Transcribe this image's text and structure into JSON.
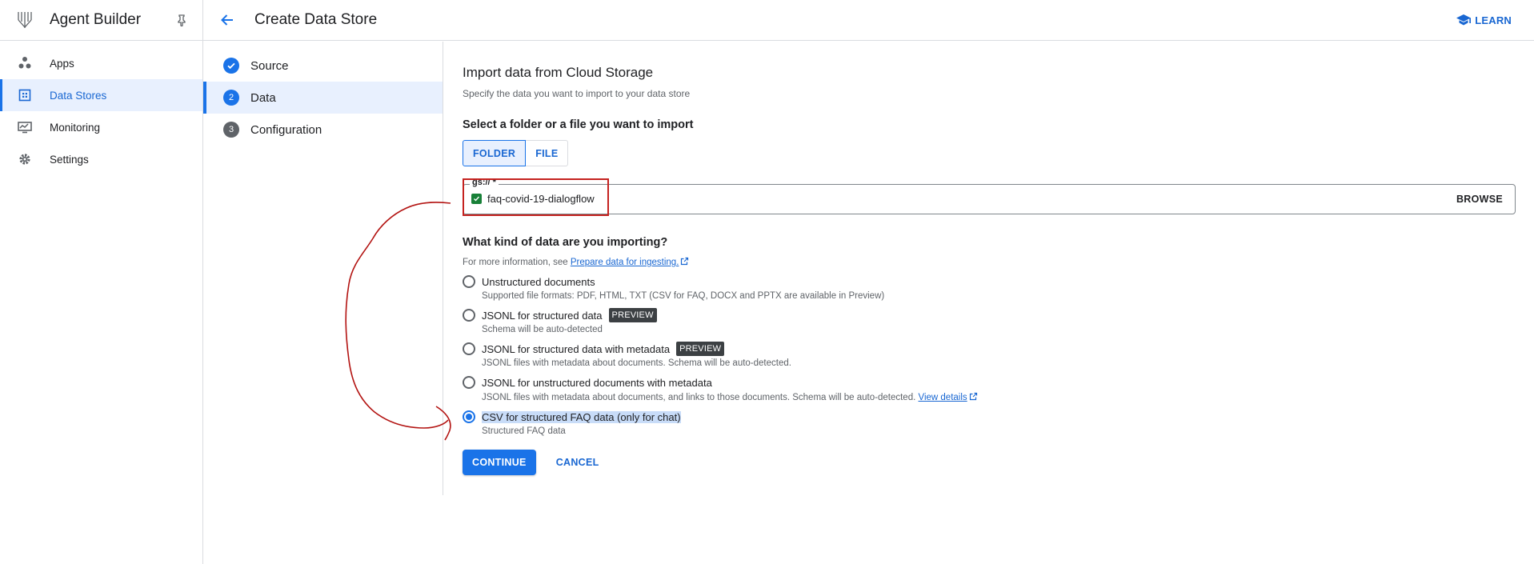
{
  "app": {
    "title": "Agent Builder"
  },
  "sidebar": {
    "items": [
      {
        "label": "Apps",
        "icon": "apps-icon"
      },
      {
        "label": "Data Stores",
        "icon": "data-stores-icon",
        "active": true
      },
      {
        "label": "Monitoring",
        "icon": "monitoring-icon"
      },
      {
        "label": "Settings",
        "icon": "gear-icon"
      }
    ]
  },
  "header": {
    "title": "Create Data Store",
    "learn_label": "LEARN"
  },
  "steps": [
    {
      "num": "",
      "label": "Source",
      "state": "done"
    },
    {
      "num": "2",
      "label": "Data",
      "state": "current"
    },
    {
      "num": "3",
      "label": "Configuration",
      "state": "pending"
    }
  ],
  "main": {
    "title": "Import data from Cloud Storage",
    "subtitle": "Specify the data you want to import to your data store",
    "select_heading": "Select a folder or a file you want to import",
    "toggle": {
      "folder": "FOLDER",
      "file": "FILE",
      "selected": "FOLDER"
    },
    "gs_field": {
      "label": "gs:// *",
      "value": "faq-covid-19-dialogflow",
      "browse": "BROWSE"
    },
    "kind_heading": "What kind of data are you importing?",
    "info_prefix": "For more information, see ",
    "info_link": "Prepare data for ingesting.",
    "options": [
      {
        "title": "Unstructured documents",
        "desc": "Supported file formats: PDF, HTML, TXT (CSV for FAQ, DOCX and PPTX are available in Preview)",
        "badge": ""
      },
      {
        "title": "JSONL for structured data",
        "desc": "Schema will be auto-detected",
        "badge": "PREVIEW"
      },
      {
        "title": "JSONL for structured data with metadata",
        "desc": "JSONL files with metadata about documents. Schema will be auto-detected.",
        "badge": "PREVIEW"
      },
      {
        "title": "JSONL for unstructured documents with metadata",
        "desc": "JSONL files with metadata about documents, and links to those documents. Schema will be auto-detected.",
        "badge": "",
        "link": "View details"
      },
      {
        "title": "CSV for structured FAQ data (only for chat)",
        "desc": "Structured FAQ data",
        "badge": "",
        "selected": true
      }
    ],
    "continue_label": "CONTINUE",
    "cancel_label": "CANCEL"
  },
  "colors": {
    "accent": "#1a73e8",
    "annotation": "#c5221f",
    "selection": "#c8dcf8"
  }
}
